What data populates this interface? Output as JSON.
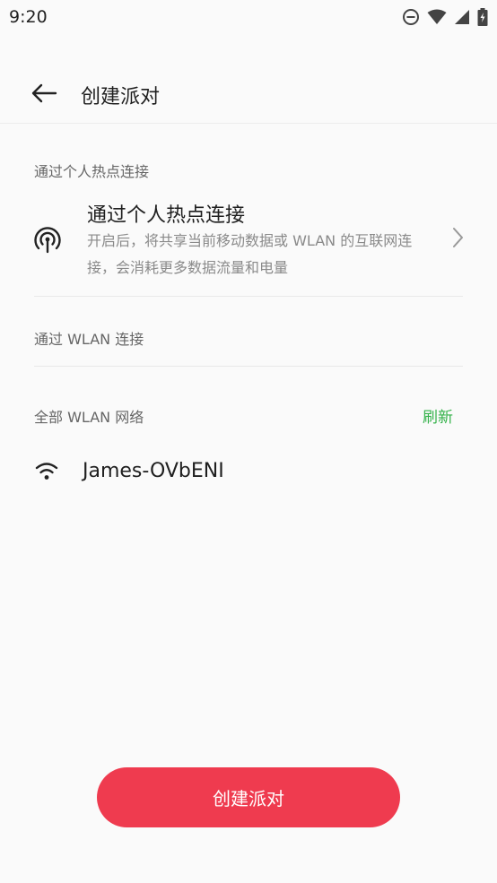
{
  "status_bar": {
    "time": "9:20"
  },
  "header": {
    "title": "创建派对"
  },
  "sections": {
    "hotspot_label": "通过个人热点连接",
    "wlan_label": "通过 WLAN 连接",
    "all_wlan_label": "全部 WLAN 网络"
  },
  "hotspot_item": {
    "title": "通过个人热点连接",
    "description": "开启后，将共享当前移动数据或 WLAN 的互联网连接，会消耗更多数据流量和电量"
  },
  "refresh_label": "刷新",
  "networks": [
    {
      "name": "James-OVbENI"
    }
  ],
  "create_button_label": "创建派对",
  "colors": {
    "accent_red": "#ef3b4f",
    "refresh_green": "#34b24a",
    "background": "#fafafa"
  }
}
